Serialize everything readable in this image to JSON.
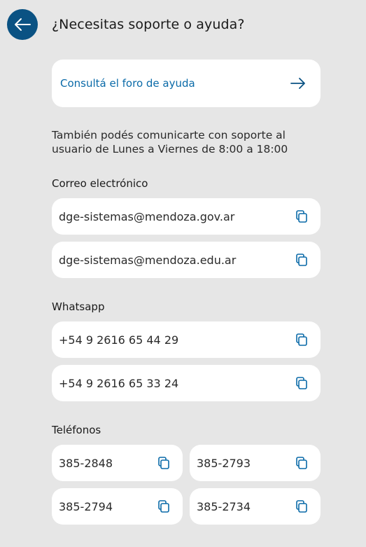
{
  "header": {
    "title": "¿Necesitas soporte o ayuda?"
  },
  "forum": {
    "label": "Consultá el foro de ayuda"
  },
  "info": {
    "text": "También podés comunicarte con soporte al usuario de Lunes a Viernes de 8:00 a 18:00"
  },
  "email": {
    "title": "Correo electrónico",
    "items": [
      "dge-sistemas@mendoza.gov.ar",
      "dge-sistemas@mendoza.edu.ar"
    ]
  },
  "whatsapp": {
    "title": "Whatsapp",
    "items": [
      "+54 9 2616 65 44 29",
      "+54 9 2616 65 33 24"
    ]
  },
  "phones": {
    "title": "Teléfonos",
    "items": [
      "385-2848",
      "385-2793",
      "385-2794",
      "385-2734"
    ]
  },
  "colors": {
    "accent": "#0a5283",
    "link": "#0a6aa8",
    "background": "#e6e6e6",
    "card": "#ffffff"
  },
  "icons": {
    "back": "arrow-left-icon",
    "forum": "arrow-right-icon",
    "copy": "copy-icon"
  }
}
